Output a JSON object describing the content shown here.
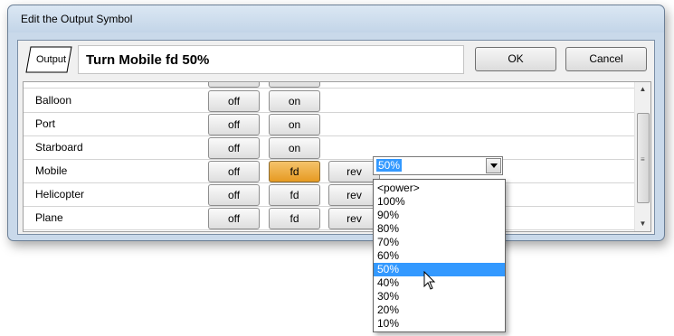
{
  "window": {
    "title": "Edit the Output Symbol"
  },
  "header": {
    "icon_label": "Output",
    "title": "Turn Mobile fd 50%",
    "ok_label": "OK",
    "cancel_label": "Cancel"
  },
  "rows": [
    {
      "label": "Balloon",
      "buttons": [
        "off",
        "on"
      ]
    },
    {
      "label": "Port",
      "buttons": [
        "off",
        "on"
      ]
    },
    {
      "label": "Starboard",
      "buttons": [
        "off",
        "on"
      ]
    },
    {
      "label": "Mobile",
      "buttons": [
        "off",
        "fd",
        "rev"
      ],
      "active": "fd"
    },
    {
      "label": "Helicopter",
      "buttons": [
        "off",
        "fd",
        "rev"
      ]
    },
    {
      "label": "Plane",
      "buttons": [
        "off",
        "fd",
        "rev"
      ]
    }
  ],
  "power_combo": {
    "selected": "50%",
    "options": [
      "<power>",
      "100%",
      "90%",
      "80%",
      "70%",
      "60%",
      "50%",
      "40%",
      "30%",
      "20%",
      "10%"
    ]
  },
  "colors": {
    "active_button": "#e69a22",
    "selection": "#3399ff"
  }
}
